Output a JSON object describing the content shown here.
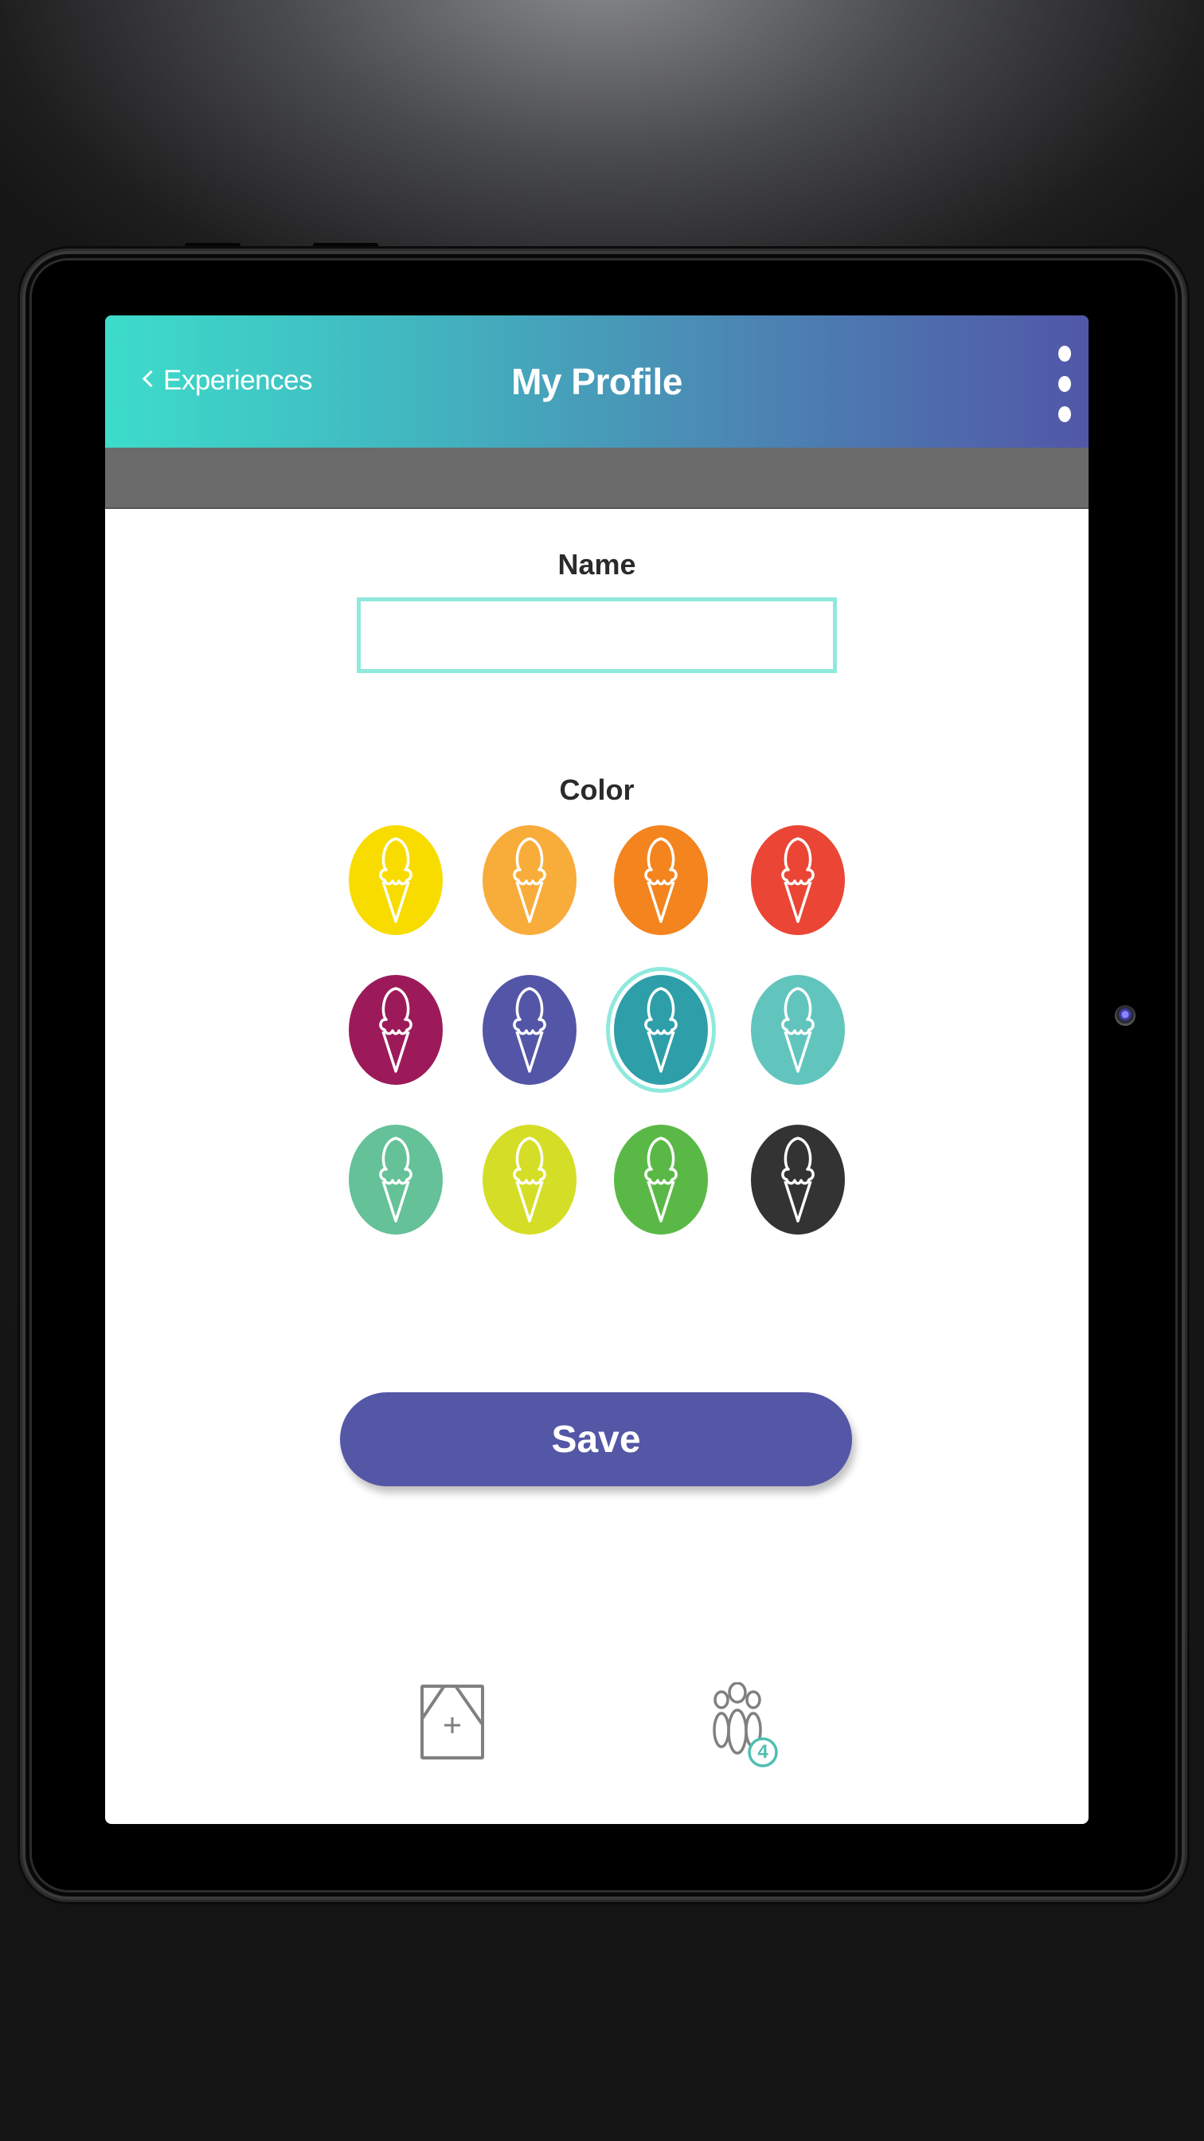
{
  "header": {
    "back_label": "Experiences",
    "title": "My Profile",
    "back_icon": "chevron-left-icon",
    "menu_icon": "more-vertical-icon"
  },
  "form": {
    "name_label": "Name",
    "name_value": "",
    "name_placeholder": "",
    "color_label": "Color",
    "selected_color_index": 6,
    "swatch_icon": "ice-cream-cone-icon",
    "colors": [
      {
        "name": "yellow",
        "hex": "#f8dc00"
      },
      {
        "name": "light-orange",
        "hex": "#f8ac3a"
      },
      {
        "name": "orange",
        "hex": "#f3841e"
      },
      {
        "name": "red",
        "hex": "#ea4535"
      },
      {
        "name": "magenta",
        "hex": "#9c1a5a"
      },
      {
        "name": "indigo",
        "hex": "#5356a6"
      },
      {
        "name": "teal",
        "hex": "#2e9ea9"
      },
      {
        "name": "aqua",
        "hex": "#61c5bd"
      },
      {
        "name": "mint",
        "hex": "#64c198"
      },
      {
        "name": "lime",
        "hex": "#d5de26"
      },
      {
        "name": "green",
        "hex": "#5ab946"
      },
      {
        "name": "black",
        "hex": "#333333"
      }
    ],
    "save_label": "Save"
  },
  "bottom_nav": {
    "add_experience_icon": "add-experience-icon",
    "people_icon": "people-icon",
    "people_count": "4"
  },
  "theme": {
    "accent": "#8fe9dd",
    "header_gradient_start": "#3ddccb",
    "header_gradient_end": "#5157a8",
    "button": "#5456a6",
    "badge": "#4dbfb2"
  }
}
